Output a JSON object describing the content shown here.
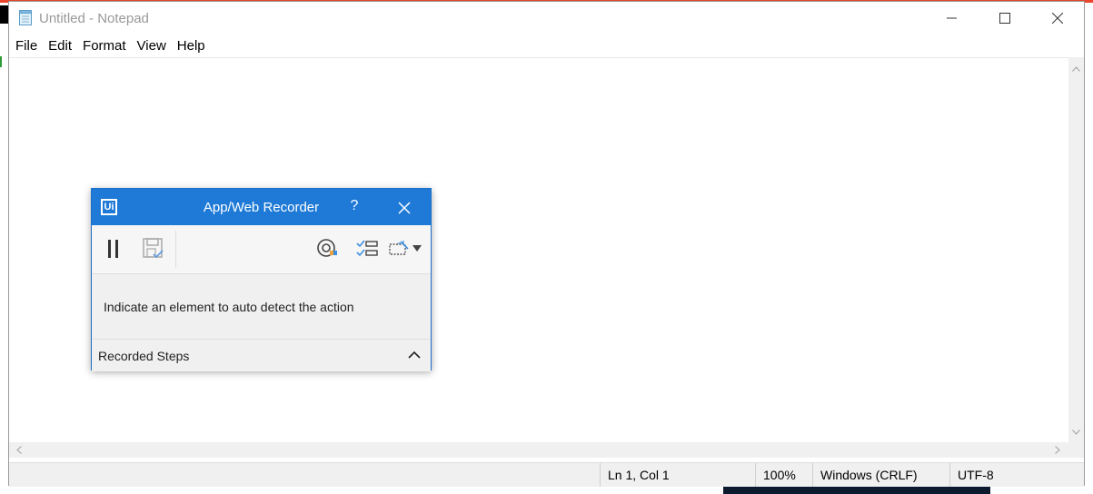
{
  "window": {
    "title": "Untitled - Notepad"
  },
  "menu": [
    "File",
    "Edit",
    "Format",
    "View",
    "Help"
  ],
  "status": {
    "position": "Ln 1, Col 1",
    "zoom": "100%",
    "line_ending": "Windows (CRLF)",
    "encoding": "UTF-8"
  },
  "recorder": {
    "logo_text": "Ui",
    "title": "App/Web Recorder",
    "help": "?",
    "message": "Indicate an element to auto detect the action",
    "steps_label": "Recorded Steps",
    "toolbar_icons": [
      "pause-icon",
      "save-icon",
      "target-icon",
      "steps-list-icon",
      "selector-icon"
    ]
  },
  "colors": {
    "recorder_accent": "#1e7ad6",
    "background_accent": "#e8452c"
  }
}
